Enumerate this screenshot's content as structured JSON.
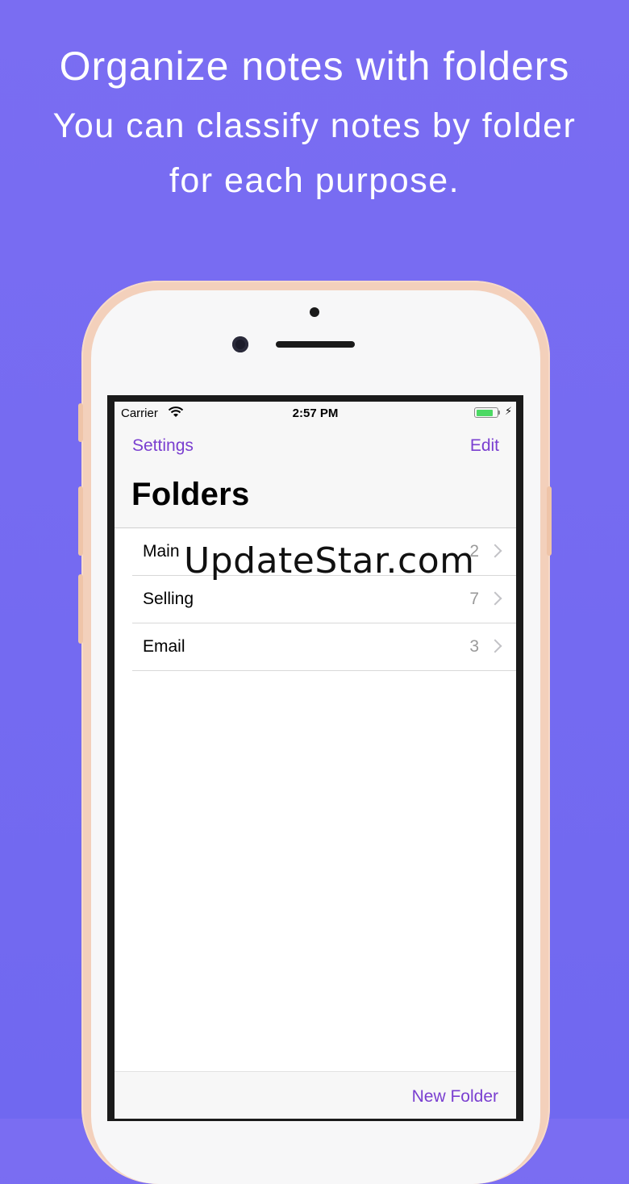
{
  "promo": {
    "headline": "Organize notes with folders",
    "subline_1": "You can classify notes by folder",
    "subline_2": "for each purpose."
  },
  "statusbar": {
    "carrier": "Carrier",
    "time": "2:57 PM",
    "battery_level": 0.85,
    "charging_icon": "bolt-icon"
  },
  "navbar": {
    "left_button": "Settings",
    "right_button": "Edit",
    "title": "Folders"
  },
  "folders": [
    {
      "name": "Main",
      "count": "2"
    },
    {
      "name": "Selling",
      "count": "7"
    },
    {
      "name": "Email",
      "count": "3"
    }
  ],
  "toolbar": {
    "new_folder": "New Folder"
  },
  "watermark": "UpdateStar.com",
  "colors": {
    "background": "#7569f1",
    "accent": "#7a3fd0",
    "phone_frame": "#f3d0bb"
  }
}
